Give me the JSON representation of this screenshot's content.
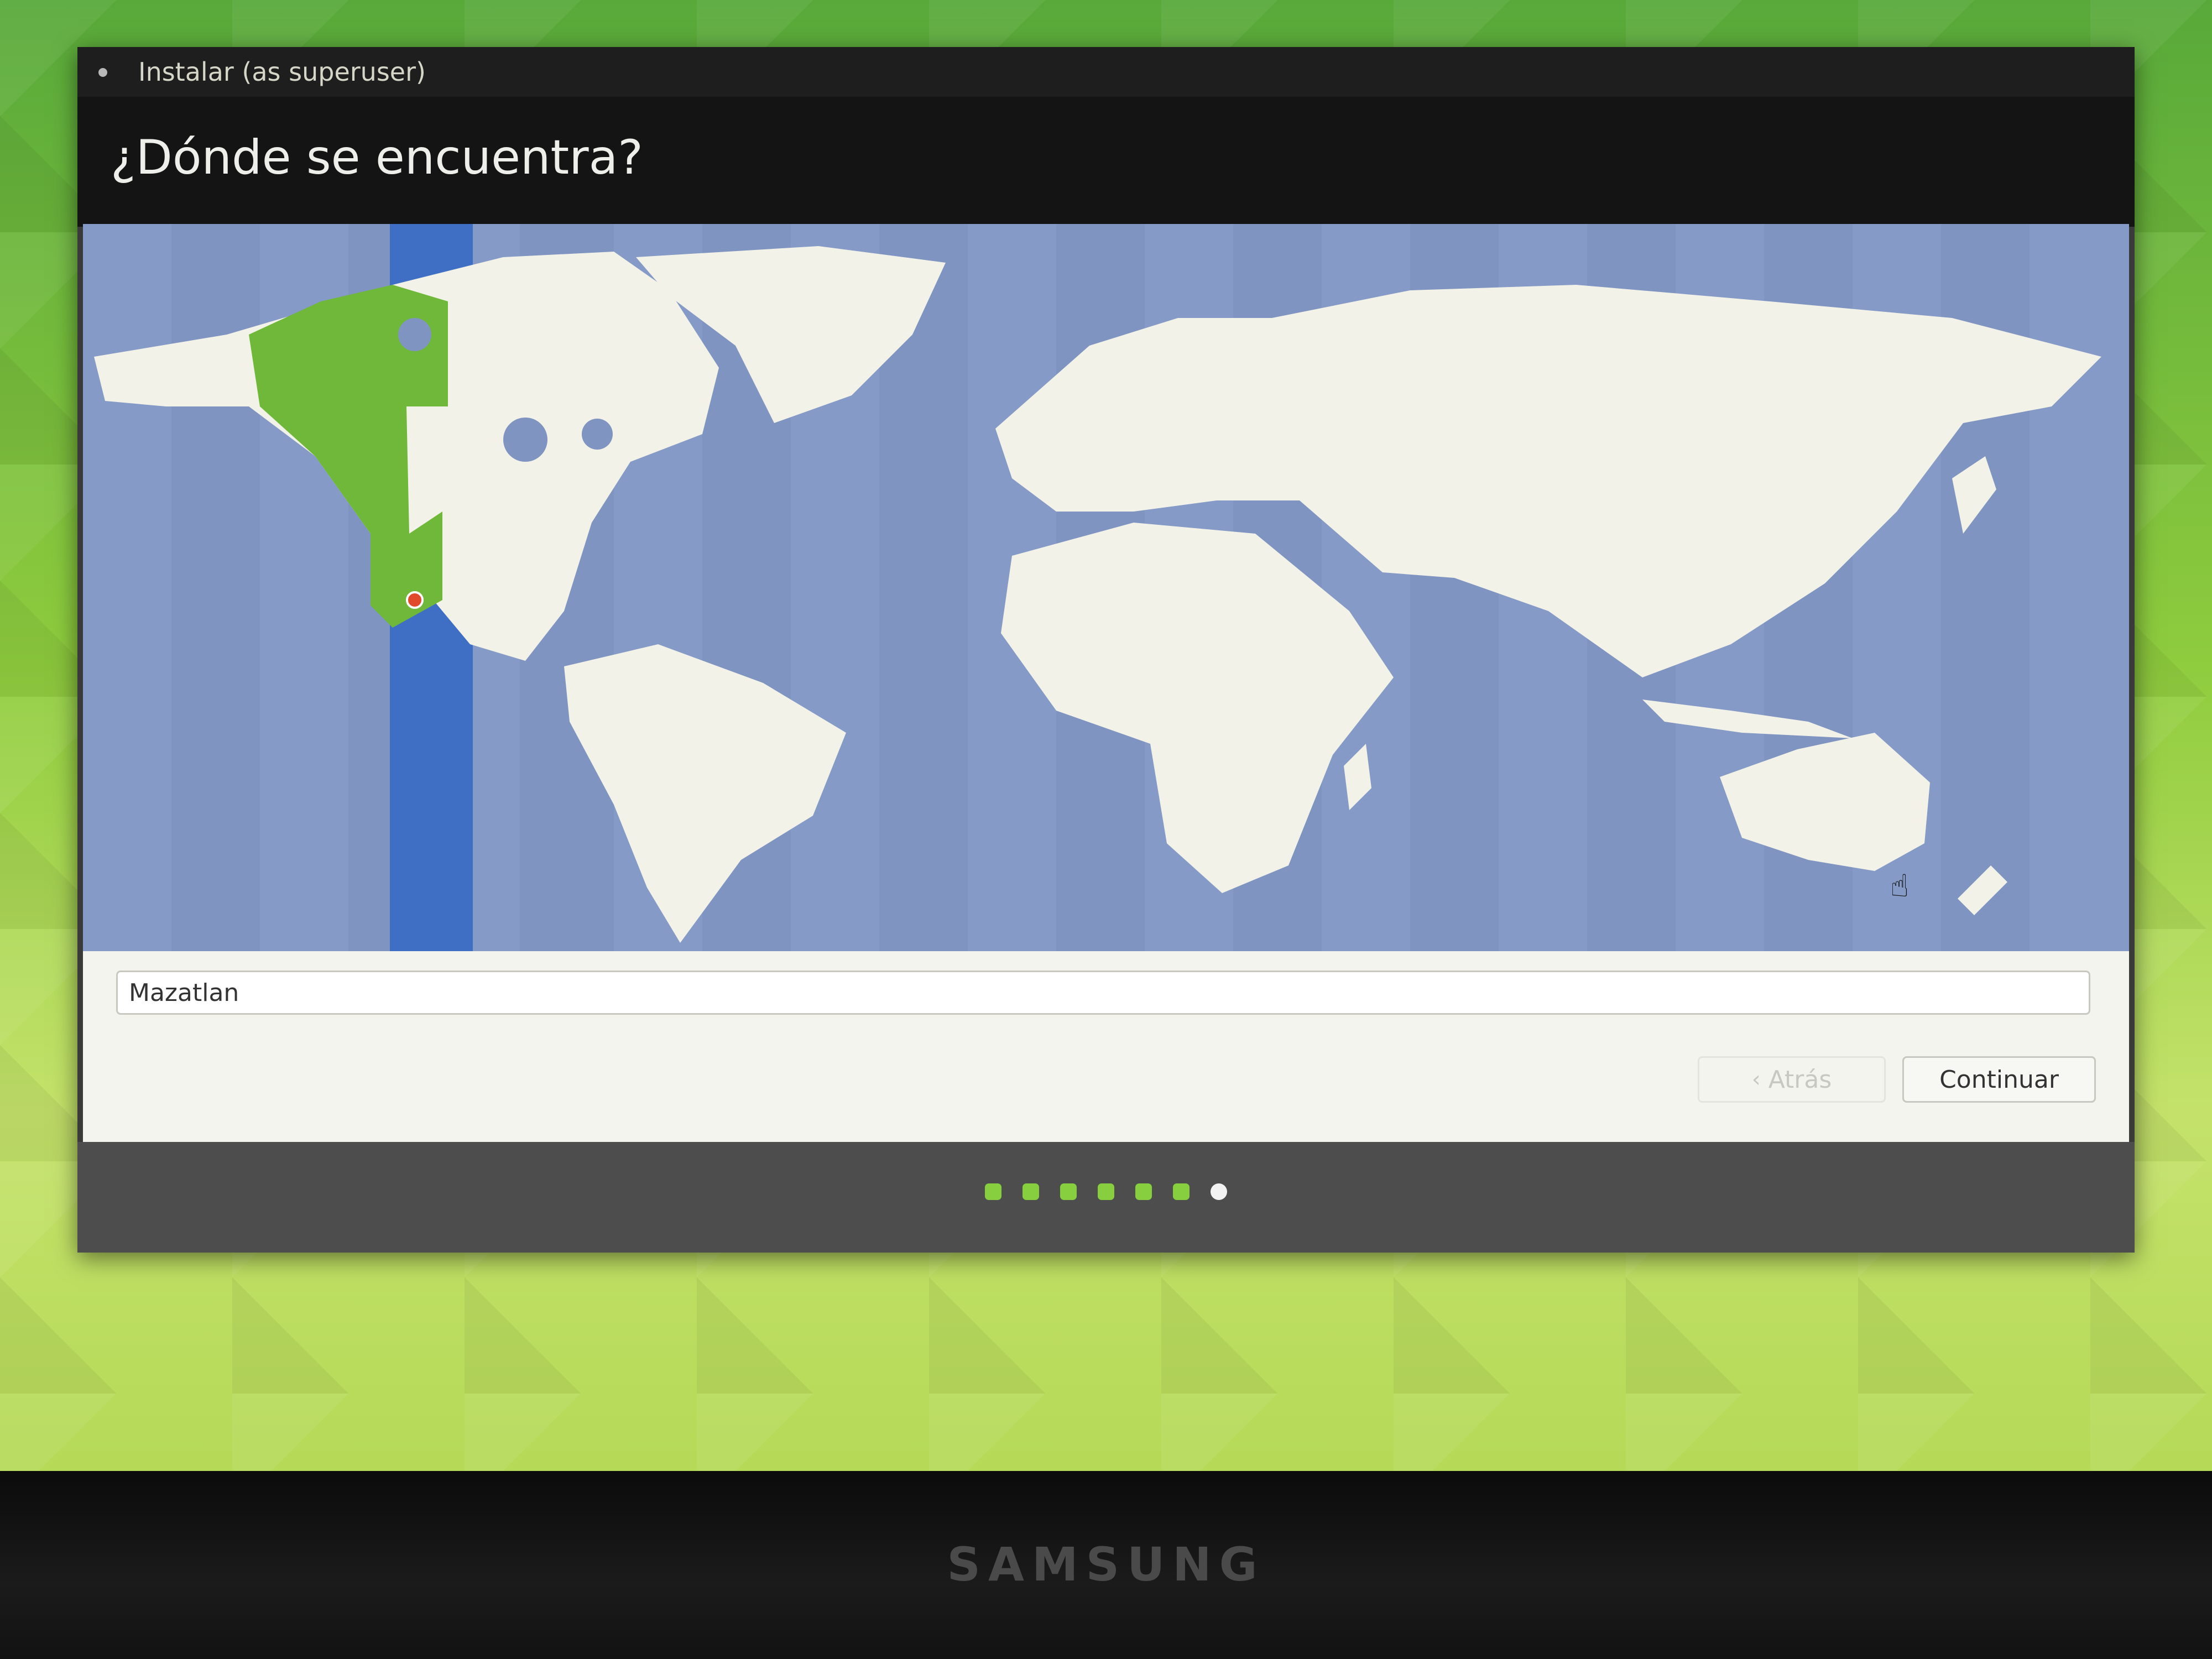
{
  "window": {
    "title": "Instalar (as superuser)",
    "heading": "¿Dónde se encuentra?"
  },
  "timezone": {
    "value": "Mazatlan",
    "selected_region": "America/Mazatlan"
  },
  "buttons": {
    "back_label": "Atrás",
    "back_icon": "chevron-left-icon",
    "continue_label": "Continuar"
  },
  "progress": {
    "total_steps": 7,
    "current_step": 7
  },
  "monitor": {
    "brand": "SAMSUNG"
  },
  "colors": {
    "ocean": "#7f94c1",
    "land": "#f2f2e8",
    "selected_timezone": "#6fb83a",
    "highlight_band": "#3f6fc4",
    "progress_done": "#87cf3e",
    "progress_current": "#f2f2f2"
  }
}
